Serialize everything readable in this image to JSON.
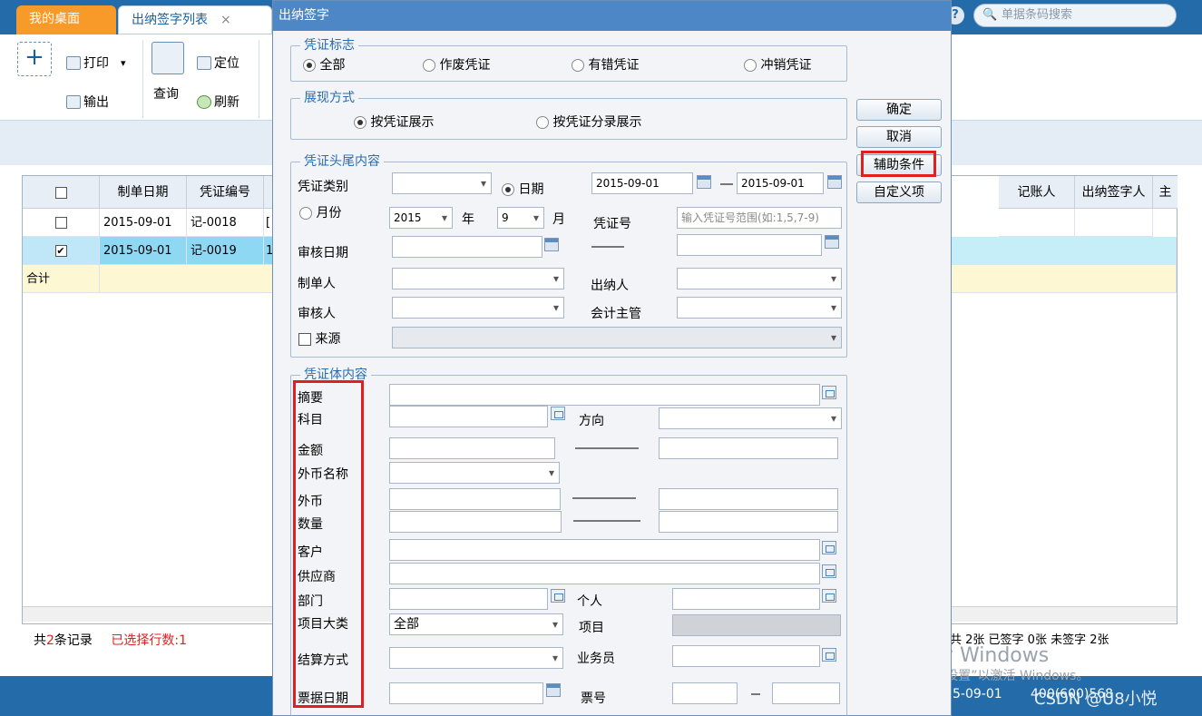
{
  "tabs": {
    "desk": "我的桌面",
    "sign": "出纳签字列表",
    "close": "×"
  },
  "search": {
    "placeholder": "单据条码搜索",
    "help": "?"
  },
  "toolbar": {
    "print": "打印",
    "locate": "定位",
    "output": "输出",
    "query": "查询",
    "refresh": "刷新",
    "add": "+",
    "print_arrow": "▾"
  },
  "grid": {
    "headers": [
      "制单日期",
      "凭证编号",
      "记账人",
      "出纳签字人",
      "主"
    ],
    "rows": [
      {
        "checked": false,
        "date": "2015-09-01",
        "no": "记-0018",
        "extra": "["
      },
      {
        "checked": true,
        "date": "2015-09-01",
        "no": "记-0019",
        "extra": "1"
      }
    ],
    "total_label": "合计",
    "check_on": "✔"
  },
  "status": {
    "prefix": "共",
    "count": "2",
    "suffix": "条记录",
    "selected": "已选择行数:1",
    "right": "共 2张   已签字 0张   未签字 2张"
  },
  "bottom": {
    "date": "5-09-01",
    "code": "400(600)568"
  },
  "watermark": {
    "line1": "激活 Windows",
    "line2": "转到“设置”以激活 Windows。",
    "csdn": "CSDN @U8小悦"
  },
  "dialog": {
    "title": "出纳签字",
    "flag": {
      "legend": "凭证标志",
      "options": [
        "全部",
        "作废凭证",
        "有错凭证",
        "冲销凭证"
      ],
      "selected": 0
    },
    "display": {
      "legend": "展现方式",
      "options": [
        "按凭证展示",
        "按凭证分录展示"
      ],
      "selected": 0
    },
    "header": {
      "legend": "凭证头尾内容",
      "type_label": "凭证类别",
      "date_label": "日期",
      "month_label": "月份",
      "date_from": "2015-09-01",
      "date_to": "2015-09-01",
      "year": "2015",
      "year_label": "年",
      "month": "9",
      "month_unit": "月",
      "voucher_no_label": "凭证号",
      "voucher_no_placeholder": "输入凭证号范围(如:1,5,7-9)",
      "audit_date_label": "审核日期",
      "maker_label": "制单人",
      "cashier_label": "出纳人",
      "auditor_label": "审核人",
      "supervisor_label": "会计主管",
      "source_label": "来源"
    },
    "body": {
      "legend": "凭证体内容",
      "summary": "摘要",
      "subject": "科目",
      "direction": "方向",
      "amount": "金额",
      "currency_name": "外币名称",
      "foreign": "外币",
      "quantity": "数量",
      "customer": "客户",
      "supplier": "供应商",
      "dept": "部门",
      "person": "个人",
      "project_class": "项目大类",
      "project_class_value": "全部",
      "project": "项目",
      "settle": "结算方式",
      "salesman": "业务员",
      "bill_date": "票据日期",
      "bill_no": "票号"
    },
    "buttons": {
      "ok": "确定",
      "cancel": "取消",
      "aux": "辅助条件",
      "custom": "自定义项"
    }
  }
}
